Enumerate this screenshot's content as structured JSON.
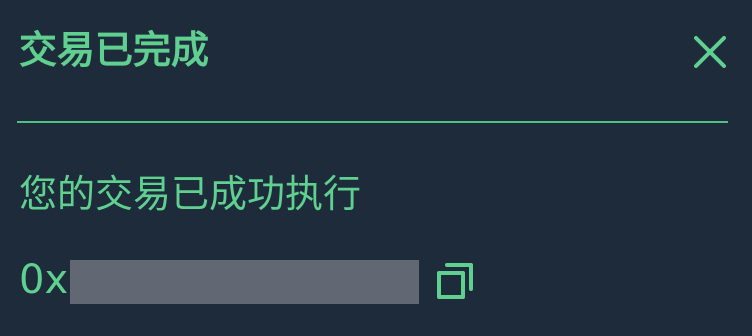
{
  "dialog": {
    "title": "交易已完成",
    "message": "您的交易已成功执行",
    "tx_hash_prefix": "0x",
    "close_icon": "close-icon",
    "copy_icon": "copy-icon"
  },
  "colors": {
    "background": "#1e2b3b",
    "accent": "#5fd08f",
    "redaction": "#626873"
  }
}
